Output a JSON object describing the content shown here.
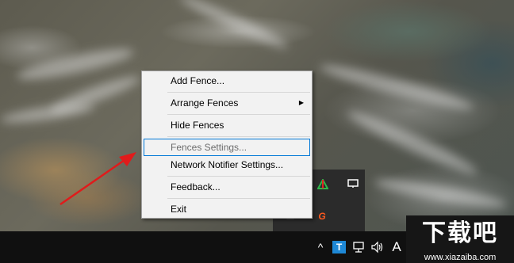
{
  "context_menu": {
    "items": [
      {
        "label": "Add Fence...",
        "disabled": false,
        "highlight": false,
        "submenu": false
      },
      {
        "label": "Arrange Fences",
        "disabled": false,
        "highlight": false,
        "submenu": true
      },
      {
        "label": "Hide Fences",
        "disabled": false,
        "highlight": false,
        "submenu": false
      },
      {
        "label": "Fences Settings...",
        "disabled": true,
        "highlight": true,
        "submenu": false
      },
      {
        "label": "Network Notifier Settings...",
        "disabled": false,
        "highlight": false,
        "submenu": false
      },
      {
        "label": "Feedback...",
        "disabled": false,
        "highlight": false,
        "submenu": false
      },
      {
        "label": "Exit",
        "disabled": false,
        "highlight": false,
        "submenu": false
      }
    ],
    "submenu_glyph": "▶"
  },
  "taskbar": {
    "tray_overflow_glyph": "^",
    "t_icon_label": "T",
    "ime_indicator": "A"
  },
  "tray_popup": {
    "g_icon_label": "G"
  },
  "watermark": {
    "logo_text": "下载吧",
    "url": "www.xiazaiba.com"
  },
  "colors": {
    "menu_bg": "#f2f2f2",
    "highlight_border": "#0078d7",
    "taskbar_bg": "#101010",
    "arrow": "#e01b1b"
  }
}
